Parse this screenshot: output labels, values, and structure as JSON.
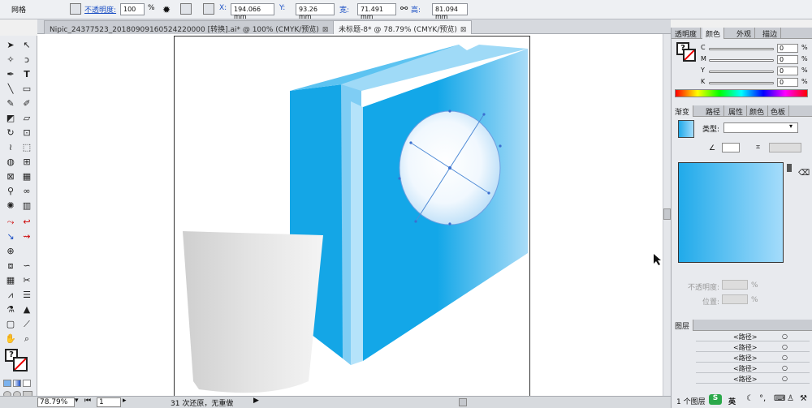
{
  "control_bar": {
    "tool_label": "网格",
    "opacity_label": "不透明度:",
    "opacity_value": "100",
    "opacity_unit": "%",
    "x_label": "X:",
    "x_value": "194.066 mm",
    "y_label": "Y:",
    "y_value": "93.26 mm",
    "w_label": "宽:",
    "w_value": "71.491 mm",
    "h_label": "高:",
    "h_value": "81.094 mm"
  },
  "tabs": [
    {
      "label": "Nipic_24377523_20180909160524220000 [转换].ai* @ 100% (CMYK/预览)",
      "close": "⊠"
    },
    {
      "label": "未标题-8* @ 78.79% (CMYK/预览)",
      "close": "⊠"
    }
  ],
  "color_panel": {
    "tabs": [
      "透明度",
      "颜色",
      "外观",
      "描边"
    ],
    "active_tab": "颜色",
    "channels": [
      {
        "label": "C",
        "value": "0"
      },
      {
        "label": "M",
        "value": "0"
      },
      {
        "label": "Y",
        "value": "0"
      },
      {
        "label": "K",
        "value": "0"
      }
    ],
    "unit": "%"
  },
  "gradient_panel": {
    "tabs": [
      "渐变",
      "路径",
      "属性",
      "颜色",
      "色板"
    ],
    "active_tab": "渐变",
    "type_label": "类型:",
    "opacity_label": "不透明度:",
    "location_label": "位置:",
    "percent": "%",
    "start_color": "#20aaea",
    "end_color": "#a5dcfb"
  },
  "layers_panel": {
    "title": "图层",
    "items": [
      "<路径>",
      "<路径>",
      "<路径>",
      "<路径>",
      "<路径>"
    ],
    "footer": "1 个图层"
  },
  "status_bar": {
    "zoom": "78.79%",
    "page": "1",
    "undo_text": "31 次还原，无重做"
  },
  "ime": {
    "logo": "S",
    "lang": "英"
  },
  "colors": {
    "accent_blue": "#00a0e9",
    "light_blue": "#9fdaf7",
    "cup_gray": "#d9d9d9"
  }
}
